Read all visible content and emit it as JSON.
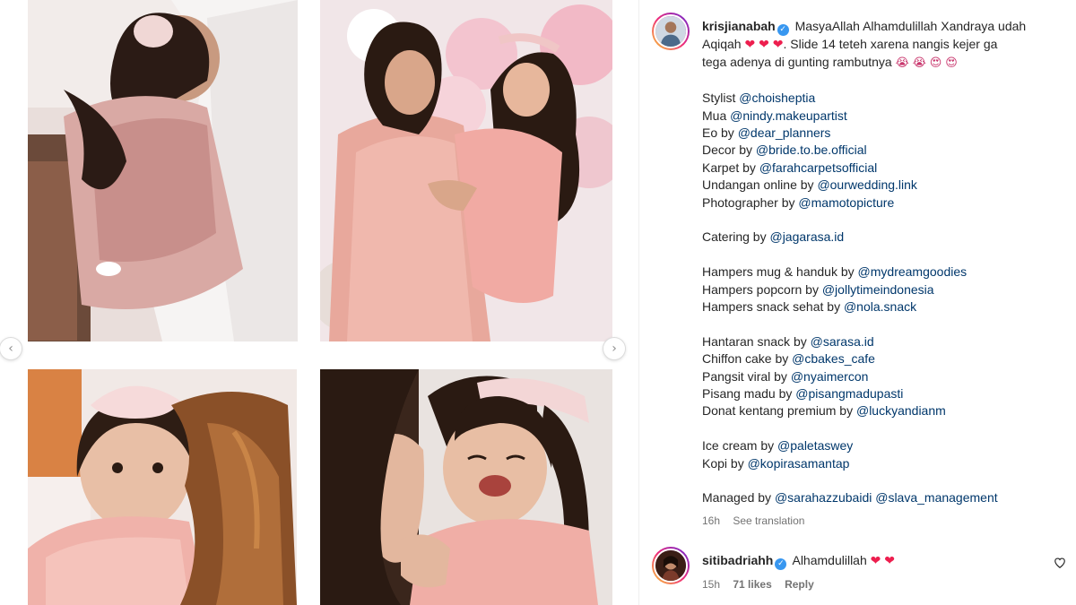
{
  "post": {
    "username": "krisjianabah",
    "caption_intro": "MasyaAllah Alhamdulillah Xandraya udah",
    "caption_intro2": "Aqiqah",
    "caption_slide": ". Slide 14 teteh xarena nangis kejer ga",
    "caption_slide2": "tega adenya di gunting rambutnya",
    "credits": [
      {
        "label": "Stylist",
        "handle": "@choisheptia"
      },
      {
        "label": "Mua",
        "handle": "@nindy.makeupartist"
      },
      {
        "label": "Eo by",
        "handle": "@dear_planners"
      },
      {
        "label": "Decor by",
        "handle": "@bride.to.be.official"
      },
      {
        "label": "Karpet by",
        "handle": "@farahcarpetsofficial"
      },
      {
        "label": "Undangan online by",
        "handle": "@ourwedding.link"
      },
      {
        "label": "Photographer by",
        "handle": "@mamotopicture"
      },
      {
        "label": "Catering by",
        "handle": "@jagarasa.id"
      },
      {
        "label": "Hampers mug & handuk by",
        "handle": "@mydreamgoodies"
      },
      {
        "label": "Hampers popcorn by",
        "handle": "@jollytimeindonesia"
      },
      {
        "label": "Hampers snack sehat by",
        "handle": "@nola.snack"
      },
      {
        "label": "Hantaran snack by",
        "handle": "@sarasa.id"
      },
      {
        "label": "Chiffon cake by",
        "handle": "@cbakes_cafe"
      },
      {
        "label": "Pangsit viral by",
        "handle": "@nyaimercon"
      },
      {
        "label": "Pisang madu by",
        "handle": "@pisangmadupasti"
      },
      {
        "label": "Donat kentang premium by",
        "handle": "@luckyandianm"
      },
      {
        "label": "Ice cream by",
        "handle": "@paletaswey"
      },
      {
        "label": "Kopi by",
        "handle": "@kopirasamantap"
      }
    ],
    "managed_label": "Managed by",
    "managed_handle_1": "@sarahazzubaidi",
    "managed_handle_2": "@slava_management",
    "time": "16h",
    "see_translation": "See translation"
  },
  "comment": {
    "username": "sitibadriahh",
    "text": "Alhamdulillah",
    "time": "15h",
    "likes": "71 likes",
    "reply": "Reply"
  },
  "icons": {
    "verified": "verified-badge-icon",
    "heart": "red-heart-emoji",
    "like": "heart-outline-icon",
    "prev": "chevron-left-icon",
    "next": "chevron-right-icon"
  },
  "colors": {
    "mention": "#00376b",
    "verified": "#3897f0",
    "meta": "#737373",
    "heart": "#ed1e4e"
  }
}
